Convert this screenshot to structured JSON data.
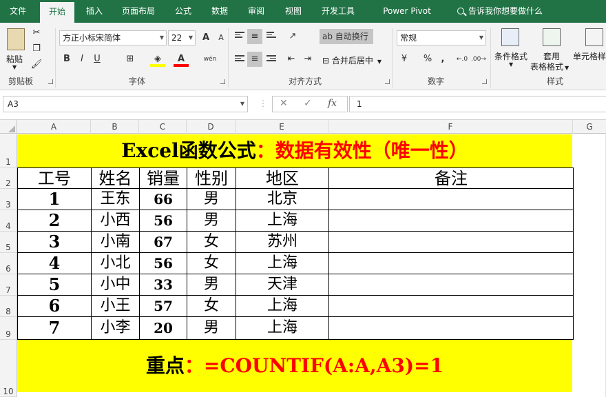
{
  "tabs": [
    "文件",
    "开始",
    "插入",
    "页面布局",
    "公式",
    "数据",
    "审阅",
    "视图",
    "开发工具",
    "Power Pivot"
  ],
  "active_tab": "开始",
  "tell_me": "告诉我你想要做什么",
  "ribbon": {
    "clipboard": {
      "paste": "粘贴",
      "group": "剪贴板"
    },
    "font": {
      "name": "方正小标宋简体",
      "size": "22",
      "bold": "B",
      "italic": "I",
      "underline": "U",
      "grow": "A",
      "shrink": "A",
      "color_a": "A",
      "phonetic": "wén",
      "group": "字体"
    },
    "alignment": {
      "wrap": "自动换行",
      "merge": "合并后居中",
      "group": "对齐方式"
    },
    "number": {
      "format": "常规",
      "percent": "%",
      "comma": ",",
      "group": "数字"
    },
    "styles": {
      "conditional": "条件格式",
      "table_line1": "套用",
      "table_line2": "表格格式",
      "cell_styles": "单元格样",
      "group": "样式"
    }
  },
  "formula_bar": {
    "name_box": "A3",
    "fx": "fx",
    "value": "1"
  },
  "columns": [
    "A",
    "B",
    "C",
    "D",
    "E",
    "F",
    "G"
  ],
  "rows": [
    "1",
    "2",
    "3",
    "4",
    "5",
    "6",
    "7",
    "8",
    "9",
    "10"
  ],
  "sheet": {
    "title_black": "Excel函数公式",
    "title_red": "：数据有效性（唯一性）",
    "headers": [
      "工号",
      "姓名",
      "销量",
      "性别",
      "地区",
      "备注"
    ],
    "data": [
      [
        "1",
        "王东",
        "66",
        "男",
        "北京",
        ""
      ],
      [
        "2",
        "小西",
        "56",
        "男",
        "上海",
        ""
      ],
      [
        "3",
        "小南",
        "67",
        "女",
        "苏州",
        ""
      ],
      [
        "4",
        "小北",
        "56",
        "女",
        "上海",
        ""
      ],
      [
        "5",
        "小中",
        "33",
        "男",
        "天津",
        ""
      ],
      [
        "6",
        "小王",
        "57",
        "女",
        "上海",
        ""
      ],
      [
        "7",
        "小李",
        "20",
        "男",
        "上海",
        ""
      ]
    ],
    "key_black": "重点",
    "key_red": "：=COUNTIF(A:A,A3)=1"
  },
  "colors": {
    "accent": "#217346",
    "highlight": "#ffff00",
    "red": "#ff0000"
  }
}
